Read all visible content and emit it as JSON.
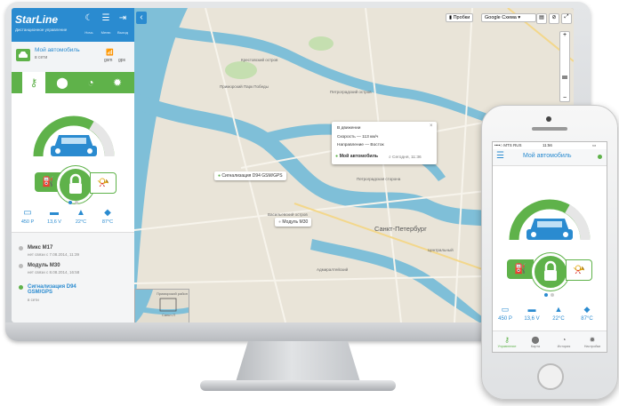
{
  "app": {
    "brand": "StarLine",
    "brand_sub": "Дистанционное управление",
    "header_buttons": [
      {
        "icon": "moon-icon",
        "label": "Ночь"
      },
      {
        "icon": "menu-icon",
        "label": "Меню"
      },
      {
        "icon": "exit-icon",
        "label": "Выход"
      }
    ]
  },
  "car": {
    "name": "Мой автомобиль",
    "status": "в сети",
    "gsm_label": "gsm",
    "gps_label": "gps"
  },
  "tabs": [
    {
      "icon": "key-icon"
    },
    {
      "icon": "location-pin-icon"
    },
    {
      "icon": "history-clock-icon"
    },
    {
      "icon": "settings-gear-icon"
    }
  ],
  "stats": [
    {
      "icon": "battery-icon",
      "value": "450 Р"
    },
    {
      "icon": "car-battery-icon",
      "value": "13,6 V"
    },
    {
      "icon": "car-temp-icon",
      "value": "22°C"
    },
    {
      "icon": "engine-temp-icon",
      "value": "87°C"
    }
  ],
  "devices": [
    {
      "name": "Микс M17",
      "sub": "нет связи с 7.08.2014, 11:39",
      "active": false
    },
    {
      "name": "Модуль M30",
      "sub": "нет связи с 8.08.2014, 16:58",
      "active": false
    },
    {
      "name": "Сигнализация D94 GSM/GPS",
      "sub": "в сети",
      "active": true
    }
  ],
  "map": {
    "traffic_label": "Пробки",
    "layer_select": "Google Схема",
    "city_label": "Санкт-Петербург",
    "minimap_label": "Приморский район",
    "minimap_label2": "Санкт-П",
    "labels": [
      "Крестовский остров",
      "Петроградский остров",
      "Васильевский остров",
      "Адмиралтейский",
      "Центральный",
      "Приморский Парк Победы",
      "Петроградская сторона"
    ],
    "markers": [
      {
        "name": "Сигнализация D94 GSM/GPS"
      },
      {
        "name": "Модуль M30"
      }
    ],
    "popup": {
      "state": "В движении",
      "speed": "Скорость — 113 км/ч",
      "direction": "Направление — Восток",
      "name": "Мой автомобиль",
      "meta": "Сегодня, 11:36"
    }
  },
  "phone": {
    "carrier": "••••○ MTS RUS",
    "time": "11:56",
    "title": "Мой автомобиль",
    "nav": [
      {
        "icon": "key-icon",
        "label": "Управление"
      },
      {
        "icon": "location-pin-icon",
        "label": "Карта"
      },
      {
        "icon": "history-clock-icon",
        "label": "История"
      },
      {
        "icon": "settings-gear-icon",
        "label": "Настройки"
      }
    ]
  },
  "colors": {
    "accent_green": "#5fb24a",
    "accent_blue": "#2a8bd0",
    "map_water": "#7fbfd8",
    "map_land": "#e9e4d8"
  }
}
